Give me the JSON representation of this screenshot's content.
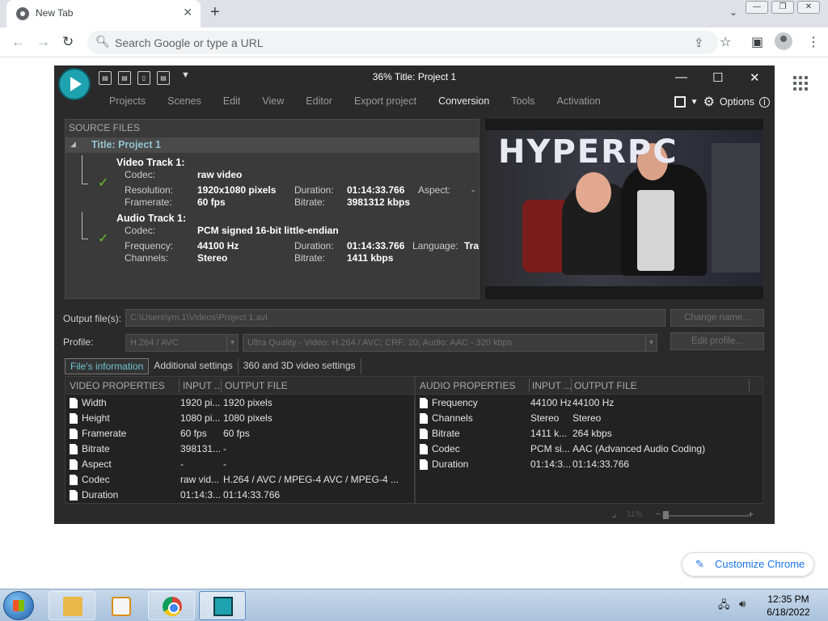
{
  "browser": {
    "tab_title": "New Tab",
    "tab_close": "✕",
    "new_tab": "+",
    "omnibox_placeholder": "Search Google or type a URL",
    "customize_label": "Customize Chrome"
  },
  "app": {
    "title": "36% Title: Project 1",
    "quick_icons": [
      "add-files-icon",
      "add-dvd-icon",
      "add-audio-icon",
      "add-capture-icon"
    ],
    "menu": [
      "Projects",
      "Scenes",
      "Edit",
      "View",
      "Editor",
      "Export project",
      "Conversion",
      "Tools",
      "Activation"
    ],
    "active_menu": "Conversion",
    "options_label": "Options",
    "source_files_header": "SOURCE FILES",
    "project_title": "Title: Project 1",
    "video_track": {
      "heading": "Video Track 1:",
      "codec_label": "Codec:",
      "codec": "raw video",
      "resolution_label": "Resolution:",
      "resolution": "1920x1080 pixels",
      "duration_label": "Duration:",
      "duration": "01:14:33.766",
      "aspect_label": "Aspect:",
      "aspect": "-",
      "framerate_label": "Framerate:",
      "framerate": "60 fps",
      "bitrate_label": "Bitrate:",
      "bitrate": "3981312 kbps"
    },
    "audio_track": {
      "heading": "Audio Track 1:",
      "codec_label": "Codec:",
      "codec": "PCM signed 16-bit little-endian",
      "frequency_label": "Frequency:",
      "frequency": "44100 Hz",
      "duration_label": "Duration:",
      "duration": "01:14:33.766",
      "language_label": "Language:",
      "language": "Tra",
      "channels_label": "Channels:",
      "channels": "Stereo",
      "bitrate_label": "Bitrate:",
      "bitrate": "1411 kbps"
    },
    "preview_logo": "HYPERPC",
    "output_label": "Output file(s):",
    "output_value": "C:\\Users\\ym.1\\Videos\\Project 1.avi",
    "change_name": "Change name...",
    "profile_label": "Profile:",
    "profile_format": "H.264 / AVC",
    "profile_quality": "Ultra Quality - Video: H.264 / AVC; CRF: 20; Audio: AAC - 320 kbps",
    "edit_profile": "Edit profile...",
    "info_tabs": [
      "File's information",
      "Additional settings",
      "360 and 3D video settings"
    ],
    "video_columns": [
      "VIDEO PROPERTIES",
      "INPUT ...",
      "OUTPUT FILE"
    ],
    "video_rows": [
      {
        "prop": "Width",
        "input": "1920 pi...",
        "output": "1920 pixels"
      },
      {
        "prop": "Height",
        "input": "1080 pi...",
        "output": "1080 pixels"
      },
      {
        "prop": "Framerate",
        "input": "60 fps",
        "output": "60 fps"
      },
      {
        "prop": "Bitrate",
        "input": "398131...",
        "output": "-"
      },
      {
        "prop": "Aspect",
        "input": "-",
        "output": "-"
      },
      {
        "prop": "Codec",
        "input": "raw vid...",
        "output": "H.264 / AVC / MPEG-4 AVC / MPEG-4 ..."
      },
      {
        "prop": "Duration",
        "input": "01:14:3...",
        "output": "01:14:33.766"
      }
    ],
    "audio_columns": [
      "AUDIO PROPERTIES",
      "INPUT ...",
      "OUTPUT FILE"
    ],
    "audio_rows": [
      {
        "prop": "Frequency",
        "input": "44100 Hz",
        "output": "44100 Hz"
      },
      {
        "prop": "Channels",
        "input": "Stereo",
        "output": "Stereo"
      },
      {
        "prop": "Bitrate",
        "input": "1411 k...",
        "output": "264 kbps"
      },
      {
        "prop": "Codec",
        "input": "PCM si...",
        "output": "AAC (Advanced Audio Coding)"
      },
      {
        "prop": "Duration",
        "input": "01:14:3...",
        "output": "01:14:33.766"
      }
    ],
    "zoom_label": "11%"
  },
  "taskbar": {
    "time": "12:35 PM",
    "date": "6/18/2022"
  }
}
